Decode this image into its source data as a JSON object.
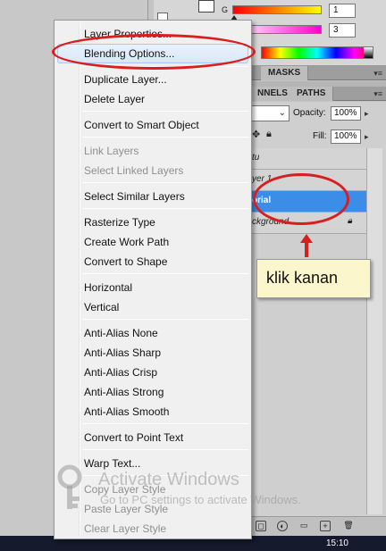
{
  "color_panel": {
    "g_label": "G",
    "value_1": "1",
    "value_2": "3",
    "colors": {
      "red_bar": "#ff0000",
      "magenta_bar": "#ff00cc"
    }
  },
  "masks_tab": {
    "label": "MASKS"
  },
  "layers_panel": {
    "tabs": [
      "NNELS",
      "PATHS"
    ],
    "opacity_label": "Opacity:",
    "opacity_value": "100%",
    "fill_label": "Fill:",
    "fill_value": "100%",
    "layers": [
      {
        "name": "tu",
        "selected": false
      },
      {
        "name": "yer 1",
        "selected": false
      },
      {
        "name": "orial",
        "selected": true
      },
      {
        "name": "ckground",
        "selected": false,
        "locked": true
      }
    ],
    "bottom_icons": [
      "link-icon",
      "fx-icon",
      "mask-icon",
      "adjustment-icon",
      "group-icon",
      "new-layer-icon",
      "trash-icon"
    ]
  },
  "context_menu": {
    "items": [
      {
        "label": "Layer Properties...",
        "disabled": false,
        "hover": false
      },
      {
        "label": "Blending Options...",
        "disabled": false,
        "hover": true
      },
      {
        "label": "Duplicate Layer...",
        "disabled": false,
        "hover": false
      },
      {
        "label": "Delete Layer",
        "disabled": false,
        "hover": false
      },
      {
        "label": "Convert to Smart Object",
        "disabled": false,
        "hover": false
      },
      {
        "label": "Link Layers",
        "disabled": true,
        "hover": false
      },
      {
        "label": "Select Linked Layers",
        "disabled": true,
        "hover": false
      },
      {
        "label": "Select Similar Layers",
        "disabled": false,
        "hover": false
      },
      {
        "label": "Rasterize Type",
        "disabled": false,
        "hover": false
      },
      {
        "label": "Create Work Path",
        "disabled": false,
        "hover": false
      },
      {
        "label": "Convert to Shape",
        "disabled": false,
        "hover": false
      },
      {
        "label": "Horizontal",
        "disabled": false,
        "hover": false
      },
      {
        "label": "Vertical",
        "disabled": false,
        "hover": false
      },
      {
        "label": "Anti-Alias None",
        "disabled": false,
        "hover": false
      },
      {
        "label": "Anti-Alias Sharp",
        "disabled": false,
        "hover": false
      },
      {
        "label": "Anti-Alias Crisp",
        "disabled": false,
        "hover": false
      },
      {
        "label": "Anti-Alias Strong",
        "disabled": false,
        "hover": false
      },
      {
        "label": "Anti-Alias Smooth",
        "disabled": false,
        "hover": false
      },
      {
        "label": "Convert to Point Text",
        "disabled": false,
        "hover": false
      },
      {
        "label": "Warp Text...",
        "disabled": false,
        "hover": false
      },
      {
        "label": "Copy Layer Style",
        "disabled": true,
        "hover": false
      },
      {
        "label": "Paste Layer Style",
        "disabled": true,
        "hover": false
      },
      {
        "label": "Clear Layer Style",
        "disabled": true,
        "hover": false
      }
    ]
  },
  "annotation": {
    "label": "klik kanan",
    "accent_color": "#d81e1e"
  },
  "watermark": {
    "title": "Activate Windows",
    "subtitle": "Go to PC settings to activate Windows."
  },
  "taskbar": {
    "clock": "15:10"
  }
}
